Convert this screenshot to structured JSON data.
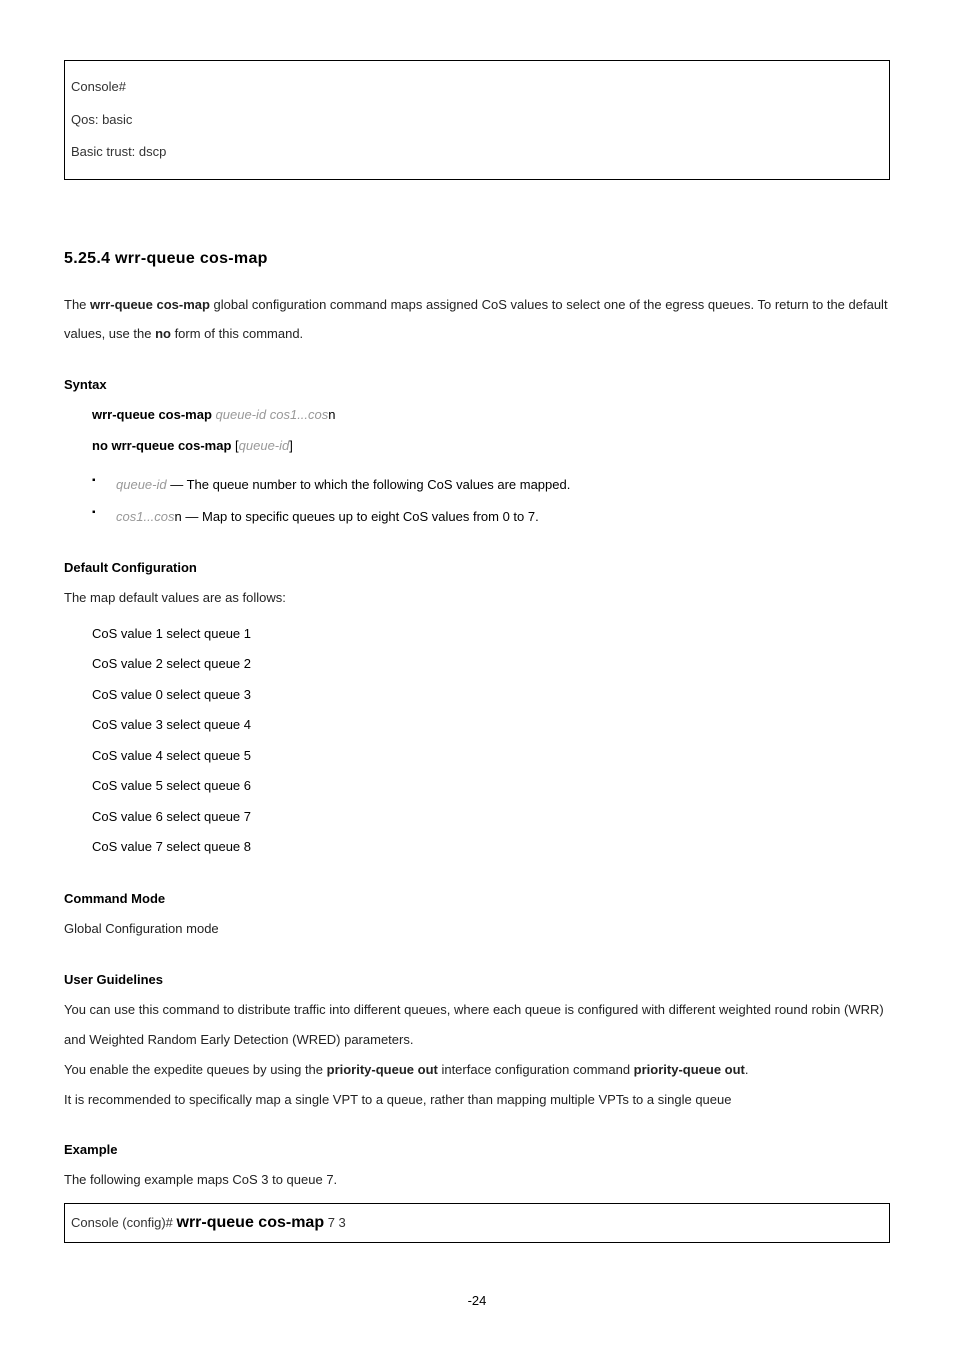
{
  "codebox": {
    "l1": "Console#",
    "l2": "Qos: basic",
    "l3": "Basic trust: dscp"
  },
  "section_title": "5.25.4 wrr-queue cos-map",
  "intro_p1a": "The ",
  "intro_cmd": "wrr-queue cos-map",
  "intro_p1b": " global configuration command maps assigned CoS values to select one of the egress queues. To return to the default values, use the ",
  "intro_no": "no",
  "intro_p1c": " form of this command.",
  "syntax": {
    "heading": "Syntax",
    "l1a": "wrr-queue cos-map ",
    "l1b": "queue-id cos1...cos",
    "l1c": "n",
    "l2a": "no wrr-queue cos-map ",
    "l2b": "[",
    "l2c": "queue-id",
    "l2d": "]",
    "b1a": "queue-id",
    "b1b": " — The queue number to which the following CoS values are mapped.",
    "b2a": "cos1...cos",
    "b2b": "n — Map to specific queues up to eight CoS values from 0 to 7."
  },
  "default": {
    "heading": "Default Configuration",
    "intro": "The map default values are as follows:",
    "items": [
      "CoS value 1 select queue 1",
      "CoS value 2 select queue 2",
      "CoS value 0 select queue 3",
      "CoS value 3 select queue 4",
      "CoS value 4 select queue 5",
      "CoS value 5 select queue 6",
      "CoS value 6 select queue 7",
      "CoS value 7 select queue 8"
    ]
  },
  "cmdmode": {
    "heading": "Command Mode",
    "text": "Global Configuration mode"
  },
  "guide": {
    "heading": "User Guidelines",
    "p1": "You can use this command to distribute traffic into different queues, where each queue is configured with different weighted round robin (WRR) and Weighted Random Early Detection (WRED) parameters.",
    "p2a": "You enable the expedite queues by using the ",
    "p2b": "priority-queue out",
    "p2c": " interface configuration command ",
    "p2d": "priority-queue out",
    "p2e": ".",
    "p3": "It is recommended to specifically map a single VPT to a queue, rather than mapping multiple VPTs to a single queue"
  },
  "example": {
    "heading": "Example",
    "intro": "The following example maps CoS 3 to queue 7.",
    "prompt": "Console (config)# ",
    "cmd": "wrr-queue cos-map",
    "args": " 7 3"
  },
  "page_number": "-24"
}
